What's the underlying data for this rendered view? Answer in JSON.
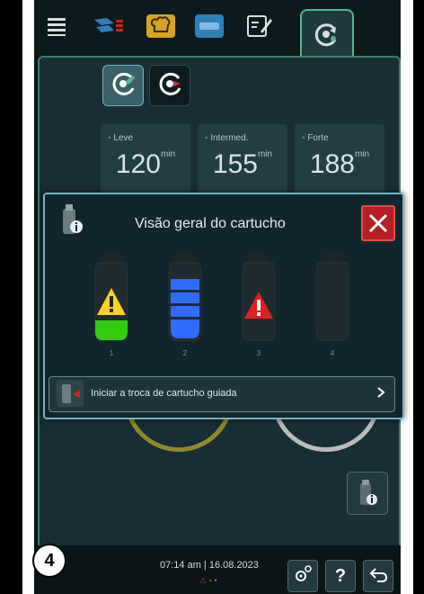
{
  "top_tabs": [
    "menu-icon",
    "gastronorm-tray-icon",
    "chef-hat-icon",
    "cooking-program-icon",
    "edit-list-icon",
    "cleaning-icon"
  ],
  "mode_tabs": [
    "care-icon",
    "care-cleaning-icon"
  ],
  "program_cards": [
    {
      "label": "Leve",
      "value": "120",
      "unit": "min"
    },
    {
      "label": "Intermed.",
      "value": "155",
      "unit": "min"
    },
    {
      "label": "Forte",
      "value": "188",
      "unit": "min"
    }
  ],
  "dialog": {
    "title": "Visão geral do cartucho",
    "cartridges": [
      {
        "number": "1",
        "status": "warning",
        "fill_fraction": 0.25,
        "fill_color": "#33cc11"
      },
      {
        "number": "2",
        "status": "full",
        "fill_fraction": 1.0,
        "fill_color": "#2f6bff"
      },
      {
        "number": "3",
        "status": "error",
        "fill_fraction": 0.0,
        "fill_color": "#e02020"
      },
      {
        "number": "4",
        "status": "empty",
        "fill_fraction": 0.0,
        "fill_color": ""
      }
    ],
    "start_button": "Iniciar a troca de cartucho guiada"
  },
  "status_bar": {
    "time": "07:14 am",
    "date": "16.08.2023"
  },
  "badge": "4",
  "colors": {
    "accent": "#55b58d",
    "warning": "#ffd21f",
    "error": "#e02020",
    "close": "#b61d22"
  }
}
